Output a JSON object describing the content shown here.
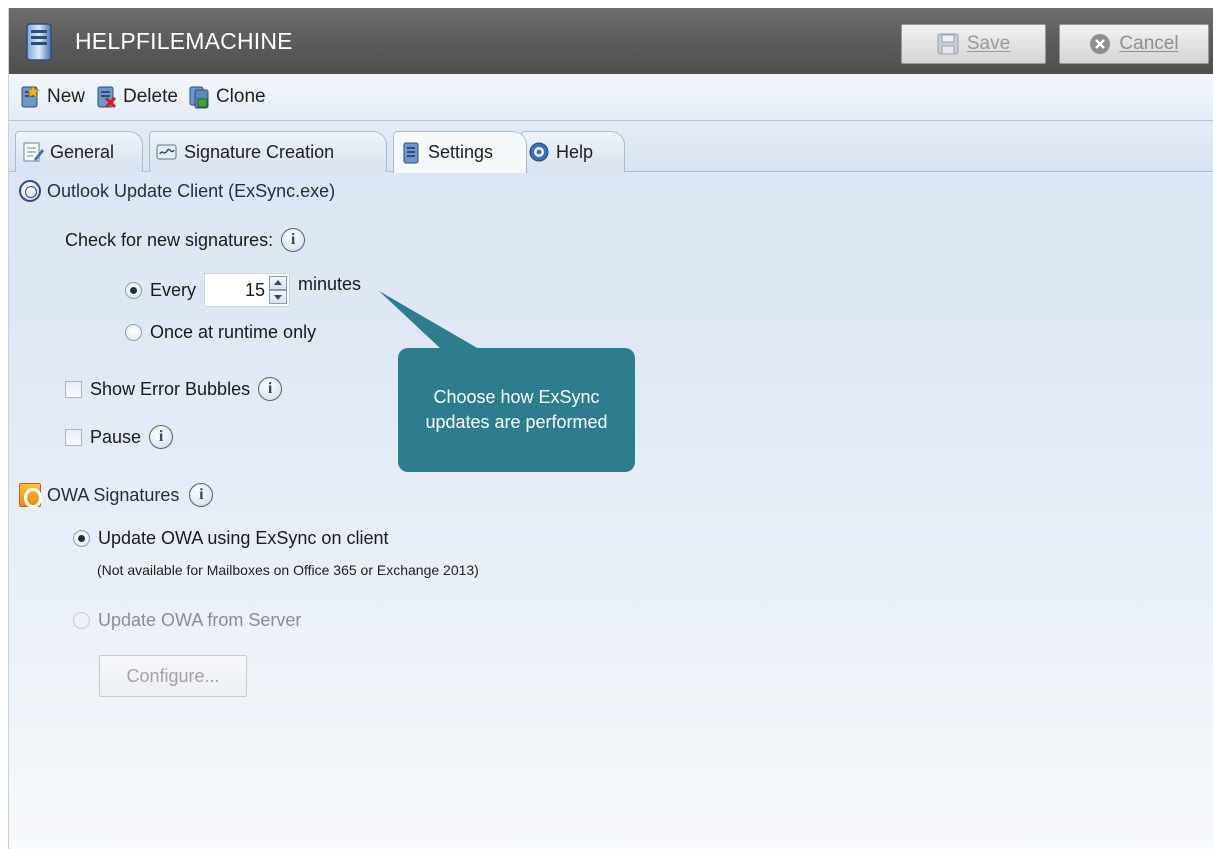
{
  "window": {
    "title": "HELPFILEMACHINE",
    "save_label": "Save",
    "cancel_label": "Cancel"
  },
  "toolbar": {
    "new_label": "New",
    "delete_label": "Delete",
    "clone_label": "Clone"
  },
  "tabs": [
    {
      "label": "General",
      "active": false
    },
    {
      "label": "Signature Creation",
      "active": false
    },
    {
      "label": "Settings",
      "active": true
    },
    {
      "label": "Help",
      "active": false
    }
  ],
  "outlook_section": {
    "title": "Outlook Update Client (ExSync.exe)",
    "check_label": "Check for new signatures:",
    "every_label": "Every",
    "interval_value": "15",
    "minutes_label": "minutes",
    "once_label": "Once at runtime only",
    "show_error_label": "Show Error Bubbles",
    "pause_label": "Pause"
  },
  "owa_section": {
    "title": "OWA Signatures",
    "update_client_label": "Update OWA using ExSync on client",
    "update_client_note": "(Not available for Mailboxes on Office 365 or Exchange 2013)",
    "update_server_label": "Update OWA from Server",
    "configure_label": "Configure..."
  },
  "callout": {
    "text": "Choose how ExSync updates are performed",
    "color": "#2e7d8e"
  },
  "colors": {
    "titlebar": "#5c5c5c",
    "accent": "#2b4a78"
  }
}
